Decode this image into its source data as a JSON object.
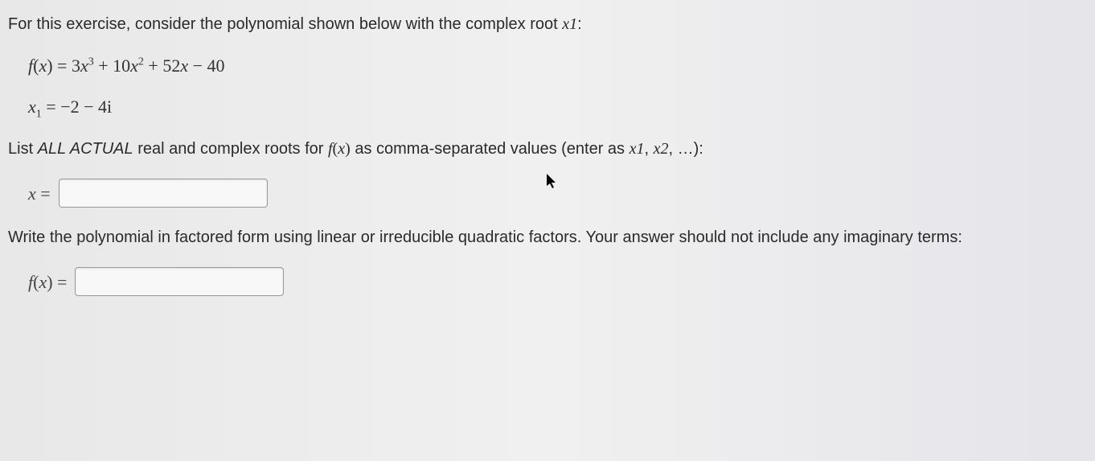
{
  "intro": {
    "text_prefix": "For this exercise, consider the polynomial shown below with the complex root ",
    "root_var": "x",
    "root_sub": "1",
    "text_suffix": ":"
  },
  "polynomial": {
    "lhs_f": "f",
    "lhs_paren_open": "(",
    "lhs_var": "x",
    "lhs_paren_close": ")",
    "equals": " = ",
    "term1_coef": "3",
    "term1_var": "x",
    "term1_exp": "3",
    "plus1": " + ",
    "term2_coef": "10",
    "term2_var": "x",
    "term2_exp": "2",
    "plus2": " + ",
    "term3_coef": "52",
    "term3_var": "x",
    "minus": " − ",
    "term4": "40"
  },
  "given_root": {
    "var": "x",
    "sub": "1",
    "equals": " = ",
    "value": "−2 − 4i"
  },
  "question1": {
    "prefix": "List ",
    "actual": "ALL ACTUAL",
    "mid": " real and complex roots for ",
    "func_f": "f",
    "func_paren_open": "(",
    "func_var": "x",
    "func_paren_close": ")",
    "suffix_a": " as comma-separated values (enter as ",
    "x1_var": "x",
    "x1_sub": "1",
    "comma": ", ",
    "x2_var": "x",
    "x2_sub": "2",
    "suffix_b": ", …):"
  },
  "input1": {
    "label_var": "x",
    "label_eq": " =",
    "value": ""
  },
  "question2": {
    "text": "Write the polynomial in factored form using linear or irreducible quadratic factors. Your answer should not include any imaginary terms:"
  },
  "input2": {
    "label_f": "f",
    "label_paren_open": "(",
    "label_var": "x",
    "label_paren_close": ")",
    "label_eq": " =",
    "value": ""
  }
}
